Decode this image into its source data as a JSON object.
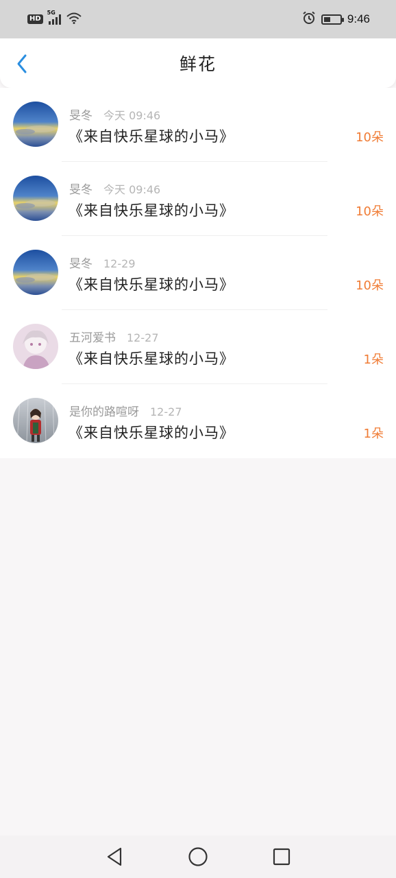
{
  "status_bar": {
    "network_badge": "HD",
    "network_type": "5G",
    "time": "9:46",
    "icons": [
      "hd-icon",
      "signal-icon",
      "wifi-icon",
      "alarm-icon",
      "battery-icon"
    ]
  },
  "header": {
    "title": "鲜花",
    "back_icon": "chevron-left-icon",
    "accent_color": "#2a8ee0"
  },
  "colors": {
    "count": "#f07c35",
    "username": "#9a9a9a",
    "date": "#b5b5b5",
    "title": "#222222"
  },
  "list": [
    {
      "username": "旻冬",
      "date": "今天 09:46",
      "title": "《来自快乐星球的小马》",
      "count": "10朵",
      "avatar": "sky-avatar"
    },
    {
      "username": "旻冬",
      "date": "今天 09:46",
      "title": "《来自快乐星球的小马》",
      "count": "10朵",
      "avatar": "sky-avatar"
    },
    {
      "username": "旻冬",
      "date": "12-29",
      "title": "《来自快乐星球的小马》",
      "count": "10朵",
      "avatar": "sky-avatar"
    },
    {
      "username": "五河爱书",
      "date": "12-27",
      "title": "《来自快乐星球的小马》",
      "count": "1朵",
      "avatar": "anime-girl-avatar"
    },
    {
      "username": "是你的路喧呀",
      "date": "12-27",
      "title": "《来自快乐星球的小马》",
      "count": "1朵",
      "avatar": "umbrella-girl-avatar"
    }
  ],
  "nav_bar": {
    "icons": [
      "back-triangle-icon",
      "home-circle-icon",
      "recents-square-icon"
    ]
  }
}
